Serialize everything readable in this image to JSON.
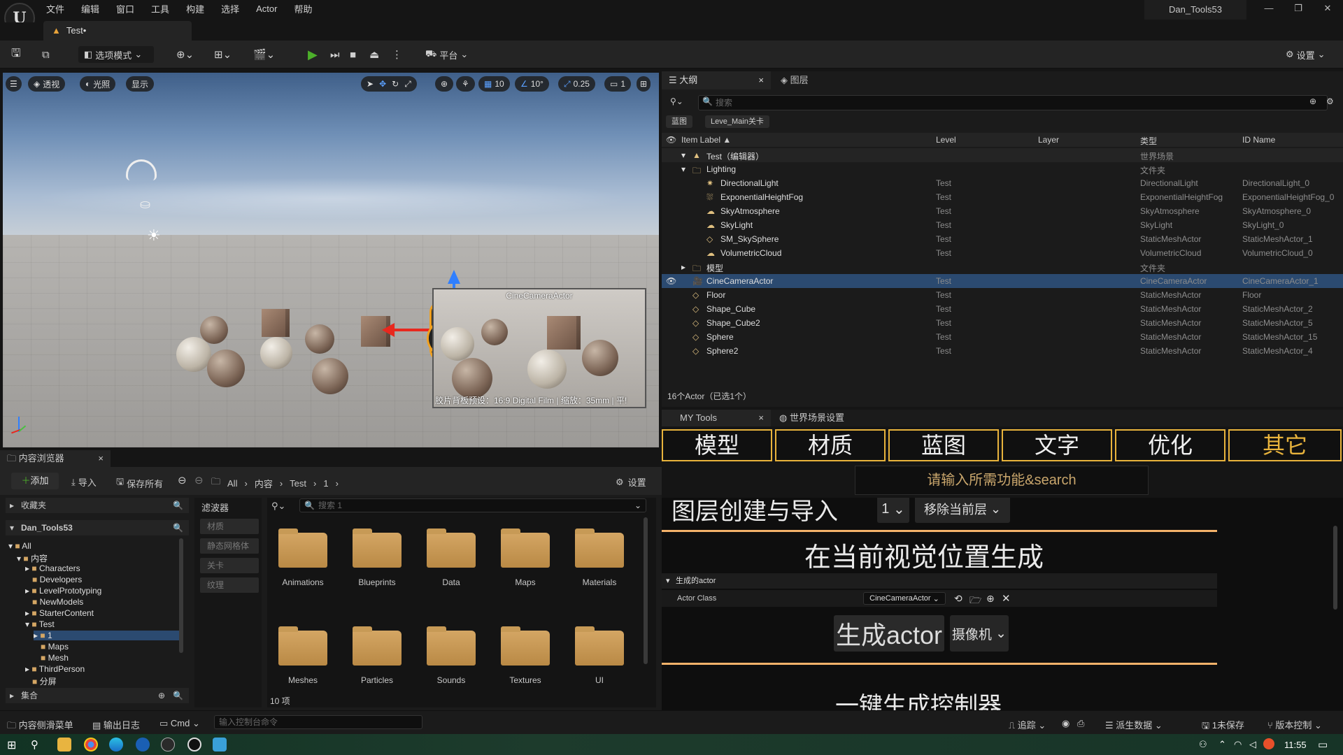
{
  "menu": [
    "文件",
    "编辑",
    "窗口",
    "工具",
    "构建",
    "选择",
    "Actor",
    "帮助"
  ],
  "project_name": "Dan_Tools53",
  "doc_tab": "Test•",
  "toolbar": {
    "mode": "选项模式",
    "platform": "平台",
    "settings": "设置"
  },
  "viewport": {
    "perspective": "透视",
    "lighting": "光照",
    "show": "显示",
    "grid_size": "10",
    "rot_snap": "10°",
    "scale_snap": "0.25",
    "cam_speed": "1",
    "camera_label": "CineCameraActor",
    "preview_caption": "胶片背板预设：16:9 Digital Film | 缩放：35mm | 平!"
  },
  "outliner": {
    "tab_label": "大纲",
    "layers_tab": "图层",
    "search_placeholder": "搜索",
    "chips": [
      "蓝图",
      "Leve_Main关卡"
    ],
    "columns": [
      "Item Label ▲",
      "Level",
      "Layer",
      "类型",
      "ID Name"
    ],
    "rows": [
      {
        "label": "Test（编辑器）",
        "level": "",
        "type": "世界场景",
        "id": ""
      },
      {
        "label": "Lighting",
        "level": "",
        "type": "文件夹",
        "id": ""
      },
      {
        "label": "DirectionalLight",
        "level": "Test",
        "type": "DirectionalLight",
        "id": "DirectionalLight_0"
      },
      {
        "label": "ExponentialHeightFog",
        "level": "Test",
        "type": "ExponentialHeightFog",
        "id": "ExponentialHeightFog_0"
      },
      {
        "label": "SkyAtmosphere",
        "level": "Test",
        "type": "SkyAtmosphere",
        "id": "SkyAtmosphere_0"
      },
      {
        "label": "SkyLight",
        "level": "Test",
        "type": "SkyLight",
        "id": "SkyLight_0"
      },
      {
        "label": "SM_SkySphere",
        "level": "Test",
        "type": "StaticMeshActor",
        "id": "StaticMeshActor_1"
      },
      {
        "label": "VolumetricCloud",
        "level": "Test",
        "type": "VolumetricCloud",
        "id": "VolumetricCloud_0"
      },
      {
        "label": "模型",
        "level": "",
        "type": "文件夹",
        "id": ""
      },
      {
        "label": "CineCameraActor",
        "level": "Test",
        "type": "CineCameraActor",
        "id": "CineCameraActor_1"
      },
      {
        "label": "Floor",
        "level": "Test",
        "type": "StaticMeshActor",
        "id": "Floor"
      },
      {
        "label": "Shape_Cube",
        "level": "Test",
        "type": "StaticMeshActor",
        "id": "StaticMeshActor_2"
      },
      {
        "label": "Shape_Cube2",
        "level": "Test",
        "type": "StaticMeshActor",
        "id": "StaticMeshActor_5"
      },
      {
        "label": "Sphere",
        "level": "Test",
        "type": "StaticMeshActor",
        "id": "StaticMeshActor_15"
      },
      {
        "label": "Sphere2",
        "level": "Test",
        "type": "StaticMeshActor",
        "id": "StaticMeshActor_4"
      }
    ],
    "status": "16个Actor（已选1个）"
  },
  "mytools": {
    "tab_label": "MY Tools",
    "world_tab": "世界场景设置",
    "categories": [
      "模型",
      "材质",
      "蓝图",
      "文字",
      "优化",
      "其它"
    ],
    "search_placeholder": "请输入所需功能&search",
    "layer_title": "图层创建与导入",
    "layer_num": "1",
    "remove_layer": "移除当前层",
    "spawn_title": "在当前视觉位置生成",
    "section": "生成的actor",
    "actor_class_label": "Actor Class",
    "actor_class_value": "CineCameraActor",
    "spawn_button": "生成actor",
    "spawn_type": "摄像机",
    "next_title": "一键生成控制器"
  },
  "content_browser": {
    "tab_label": "内容浏览器",
    "add": "添加",
    "import": "导入",
    "save_all": "保存所有",
    "settings": "设置",
    "breadcrumb": [
      "All",
      "内容",
      "Test",
      "1"
    ],
    "favorites": "收藏夹",
    "project": "Dan_Tools53",
    "collections": "集合",
    "tree": [
      "All",
      "内容",
      "Characters",
      "Developers",
      "LevelPrototyping",
      "NewModels",
      "StarterContent",
      "Test",
      "1",
      "Maps",
      "Mesh",
      "ThirdPerson",
      "分屏"
    ],
    "filters_title": "滤波器",
    "filters": [
      "材质",
      "静态网格体",
      "关卡",
      "纹理"
    ],
    "search_placeholder": "搜索 1",
    "folders": [
      "Animations",
      "Blueprints",
      "Data",
      "Maps",
      "Materials",
      "Meshes",
      "Particles",
      "Sounds",
      "Textures",
      "UI"
    ],
    "count": "10 项"
  },
  "statusbar": {
    "drawer": "内容侧滑菜单",
    "log": "输出日志",
    "cmd": "Cmd",
    "cmd_placeholder": "输入控制台命令",
    "trace": "追踪",
    "derived": "派生数据",
    "unsaved": "1未保存",
    "source": "版本控制"
  },
  "taskbar": {
    "time": "11:55"
  },
  "colors": {
    "accent": "#e8b33c",
    "selection": "#2b4a70",
    "play": "#4caf2a"
  }
}
